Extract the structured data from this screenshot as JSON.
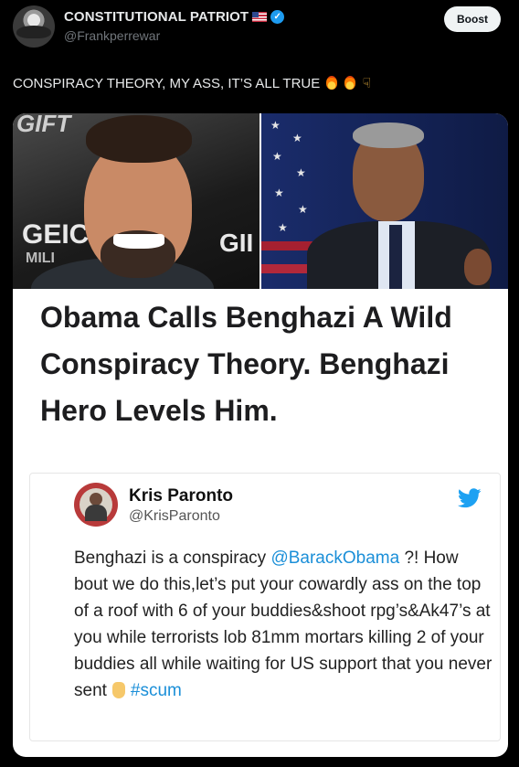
{
  "author": {
    "display_name": "CONSTITUTIONAL PATRIOT",
    "handle": "@Frankperrewar",
    "flag_icon": "us-flag-icon",
    "verified_icon": "verified-badge-icon"
  },
  "actions": {
    "boost_label": "Boost"
  },
  "tweet": {
    "text": "CONSPIRACY THEORY, MY ASS,  IT’S ALL TRUE",
    "emojis": [
      "fire-icon",
      "fire-icon",
      "pointing-down-icon"
    ]
  },
  "media": {
    "bg_text_left_top": "GIFT",
    "bg_text_left_mid": "GEIC",
    "bg_text_left_small": "MILI",
    "bg_text_center": "GII",
    "headline": "Obama Calls Benghazi A Wild Conspiracy Theory. Benghazi Hero Levels Him.",
    "quoted": {
      "name": "Kris Paronto",
      "handle": "@KrisParonto",
      "text_before_mention": "Benghazi is a conspiracy ",
      "mention": "@BarackObama",
      "text_after_mention": " ?! How bout we do this,let’s put your cowardly ass on the top of a roof with 6 of your buddies&shoot rpg’s&Ak47’s at you while terrorists lob 81mm mortars killing 2 of your buddies all while waiting for US support that you never sent",
      "hashtag": "#scum",
      "bird_icon": "twitter-bird-icon",
      "link_color": "#1b8fd8"
    }
  },
  "colors": {
    "background": "#000000",
    "text": "#e7e9ea",
    "muted": "#71767b",
    "verified": "#1d9bf0"
  }
}
